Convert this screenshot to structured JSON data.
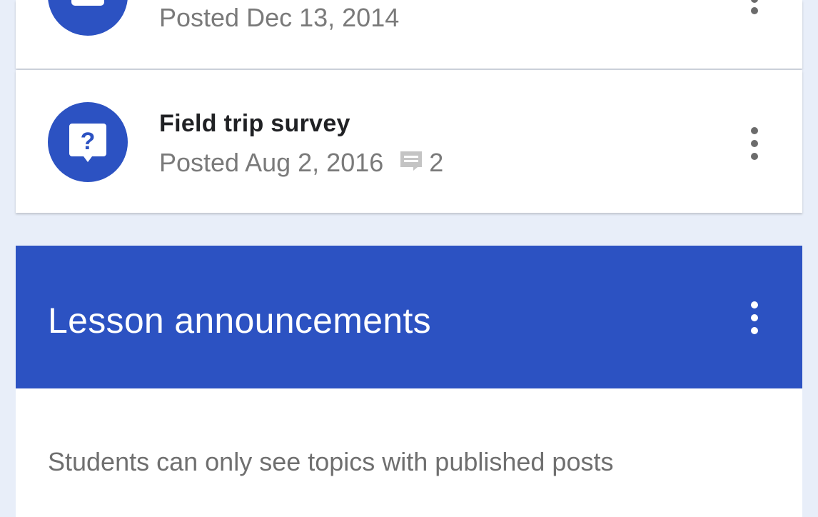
{
  "posts": [
    {
      "title": "",
      "posted": "Posted Dec 13, 2014",
      "icon": "assignment-icon"
    },
    {
      "title": "Field trip survey",
      "posted": "Posted Aug 2, 2016",
      "comment_count": "2",
      "icon": "question-icon"
    }
  ],
  "topic": {
    "title": "Lesson announcements",
    "empty_message": "Students can only see topics with published posts"
  },
  "colors": {
    "accent": "#2c52c2",
    "background": "#e8eef9",
    "card": "#ffffff",
    "meta_text": "#7a7a7a"
  }
}
